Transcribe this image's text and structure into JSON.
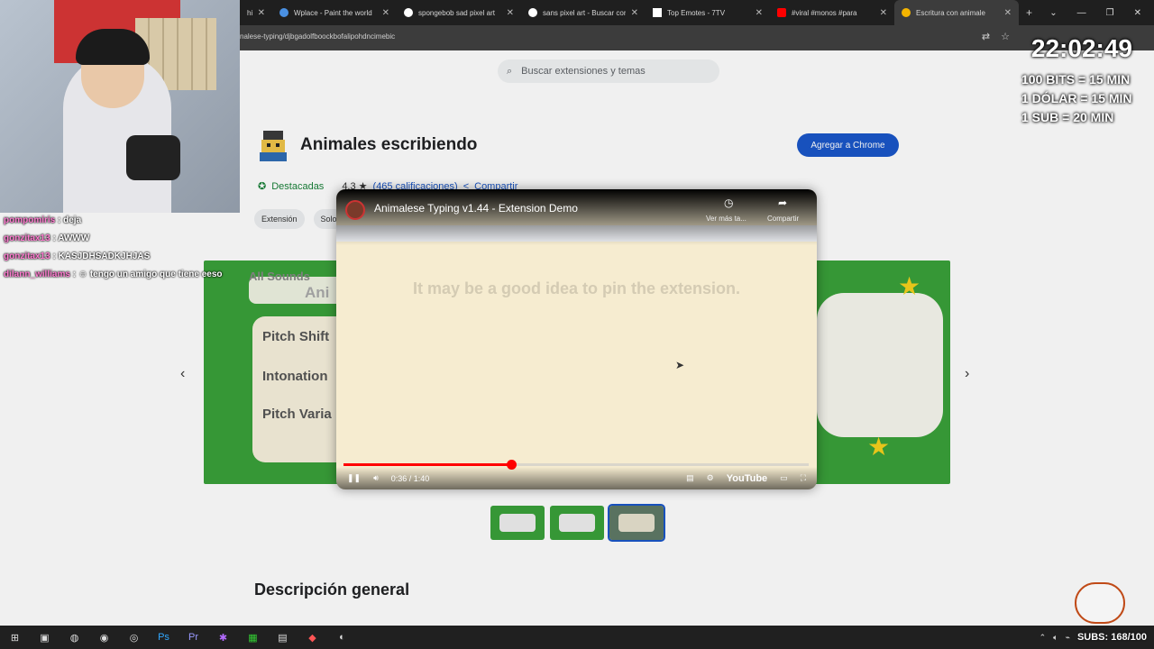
{
  "browser": {
    "tabs": [
      {
        "label": "hi",
        "favicon_color": "#888888",
        "active": false
      },
      {
        "label": "Wplace - Paint the world",
        "favicon_color": "#4a90e2",
        "active": false
      },
      {
        "label": "spongebob sad pixel art",
        "favicon_color": "#ffffff",
        "active": false
      },
      {
        "label": "sans pixel art - Buscar con",
        "favicon_color": "#ffffff",
        "active": false
      },
      {
        "label": "Top Emotes - 7TV",
        "favicon_color": "#ffffff",
        "active": false
      },
      {
        "label": "#viral #monos #para",
        "favicon_color": "#ff0000",
        "active": false
      },
      {
        "label": "Escritura con animale",
        "favicon_color": "#f4b400",
        "active": true
      }
    ],
    "new_tab": "+",
    "url": "nalese-typing/djbgadolfboockbofalipohdncimebic"
  },
  "store": {
    "search_placeholder": "Buscar extensiones y temas",
    "title": "Animales escribiendo",
    "add_button": "Agregar a Chrome",
    "featured": "Destacadas",
    "rating": "4.3 ★",
    "reviews": "(465 calificaciones)",
    "share": "Compartir",
    "chips": [
      "Extensión",
      "Solo"
    ],
    "gallery_texts": [
      "All Sounds",
      "Ani",
      "Pitch Shift",
      "Intonation",
      "Pitch Varia"
    ],
    "section_heading": "Descripción general"
  },
  "video": {
    "title": "Animalese Typing v1.44 - Extension Demo",
    "watch_later": "Ver más ta...",
    "share": "Compartir",
    "message": "It may be a good idea to pin the extension.",
    "time": "0:36 / 1:40",
    "progress": 0.36,
    "brand": "YouTube"
  },
  "chat": [
    {
      "user": "pompomiris",
      "text": "deja"
    },
    {
      "user": "gonzitax13",
      "text": "AWWW"
    },
    {
      "user": "gonzitax13",
      "text": "KASJDHSADKJHJAS"
    },
    {
      "user": "dilann_williams",
      "text": "tengo un amigo que tiene eeso"
    }
  ],
  "overlay": {
    "clock": "22:02:49",
    "rates": [
      "100 BITS = 15 MIN",
      "1 DÓLAR = 15 MIN",
      "1 SUB = 20 MIN"
    ],
    "subs": "SUBS: 168/100"
  },
  "colors": {
    "accent": "#1a57c9",
    "gallery_green": "#3aa13a",
    "youtube_red": "#ff0000"
  }
}
